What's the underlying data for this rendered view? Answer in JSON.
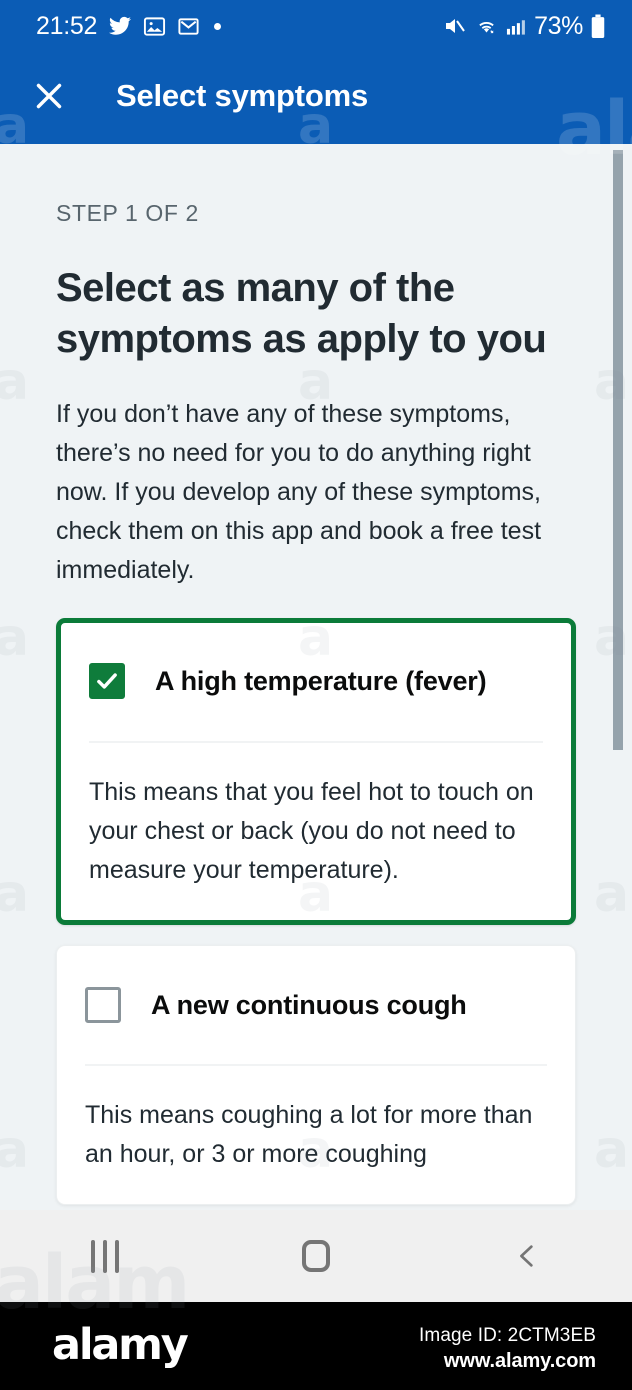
{
  "status_bar": {
    "time": "21:52",
    "battery_percent": "73%",
    "icons": [
      "twitter-icon",
      "photos-icon",
      "gmail-icon",
      "notification-dot-icon",
      "mute-icon",
      "wifi-icon",
      "signal-icon",
      "battery-icon"
    ]
  },
  "header": {
    "title": "Select symptoms",
    "close_label": "Close",
    "background_color": "#0b5cb5"
  },
  "main": {
    "step_label": "STEP 1 OF 2",
    "heading": "Select as many of the symptoms as apply to you",
    "body": "If you don’t have any of these symptoms, there’s no need for you to do anything right now. If you develop any of these symptoms, check them on this app and book a free test immediately.",
    "symptoms": [
      {
        "label": "A high temperature (fever)",
        "description": "This means that you feel hot to touch on your chest or back (you do not need to measure your temperature).",
        "checked": true
      },
      {
        "label": "A new continuous cough",
        "description": "This means coughing a lot for more than an hour, or 3 or more coughing",
        "checked": false
      }
    ],
    "accent_color": "#0f7c3b",
    "background_color": "#eff3f5"
  },
  "nav_bar": {
    "recents_label": "Recents",
    "home_label": "Home",
    "back_label": "Back"
  },
  "watermark": {
    "logo": "alamy",
    "image_id": "Image ID: 2CTM3EB",
    "url": "www.alamy.com",
    "mark_letter": "a",
    "mark_partial": "alam"
  }
}
